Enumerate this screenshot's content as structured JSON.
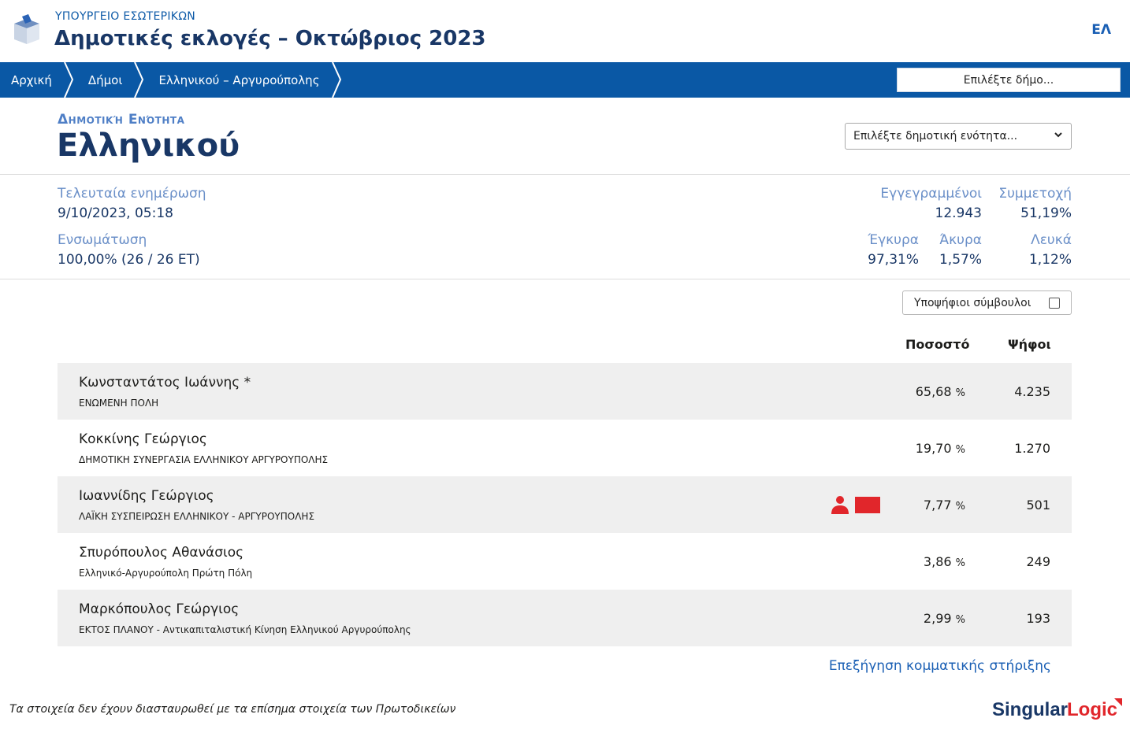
{
  "header": {
    "ministry": "ΥΠΟΥΡΓΕΙΟ ΕΣΩΤΕΡΙΚΩΝ",
    "title": "Δημοτικές εκλογές – Οκτώβριος 2023",
    "lang": "ΕΛ"
  },
  "nav": {
    "crumbs": [
      "Αρχική",
      "Δήμοι",
      "Ελληνικού – Αργυρούπολης"
    ],
    "muni_select": "Επιλέξτε δήμο..."
  },
  "unit": {
    "kicker": "Δημοτική Ενότητα",
    "name": "Ελληνικού",
    "select_placeholder": "Επιλέξτε δημοτική ενότητα..."
  },
  "stats": {
    "last_update_label": "Τελευταία ενημέρωση",
    "last_update_value": "9/10/2023, 05:18",
    "integration_label": "Ενσωμάτωση",
    "integration_value": "100,00% (26 / 26 ΕΤ)",
    "registered_label": "Εγγεγραμμένοι",
    "registered_value": "12.943",
    "turnout_label": "Συμμετοχή",
    "turnout_value": "51,19%",
    "valid_label": "Έγκυρα",
    "valid_value": "97,31%",
    "invalid_label": "Άκυρα",
    "invalid_value": "1,57%",
    "blank_label": "Λευκά",
    "blank_value": "1,12%"
  },
  "candidates_toggle": "Υποψήφιοι σύμβουλοι",
  "table": {
    "col_pct": "Ποσοστό",
    "col_votes": "Ψήφοι",
    "rows": [
      {
        "name": "Κωνσταντάτος Ιωάννης *",
        "party": "ΕΝΩΜΕΝΗ ΠΟΛΗ",
        "pct": "65,68",
        "votes": "4.235"
      },
      {
        "name": "Κοκκίνης Γεώργιος",
        "party": "ΔΗΜΟΤΙΚΗ ΣΥΝΕΡΓΑΣΙΑ ΕΛΛΗΝΙΚΟΥ ΑΡΓΥΡΟΥΠΟΛΗΣ",
        "pct": "19,70",
        "votes": "1.270"
      },
      {
        "name": "Ιωαννίδης Γεώργιος",
        "party": "ΛΑΪΚΗ ΣΥΣΠΕΙΡΩΣΗ ΕΛΛΗΝΙΚΟΥ - ΑΡΓΥΡΟΥΠΟΛΗΣ",
        "pct": "7,77",
        "votes": "501"
      },
      {
        "name": "Σπυρόπουλος Αθανάσιος",
        "party": "Ελληνικό-Αργυρούπολη Πρώτη Πόλη",
        "pct": "3,86",
        "votes": "249"
      },
      {
        "name": "Μαρκόπουλος Γεώργιος",
        "party": "ΕΚΤΟΣ ΠΛΑΝΟΥ - Αντικαπιταλιστική Κίνηση Ελληνικού Αργυρούπολης",
        "pct": "2,99",
        "votes": "193"
      }
    ],
    "pct_unit": "%"
  },
  "explain_link": "Επεξήγηση κομματικής στήριξης",
  "disclaimer": "Τα στοιχεία δεν έχουν διασταυρωθεί με τα επίσημα στοιχεία των Πρωτοδικείων",
  "brand": "SingularLogic",
  "colors": {
    "navbar": "#0a58a5",
    "title": "#193766",
    "accent_label": "#6a8fc8",
    "row_shade": "#efefef",
    "party_marker": "#e1262b"
  }
}
